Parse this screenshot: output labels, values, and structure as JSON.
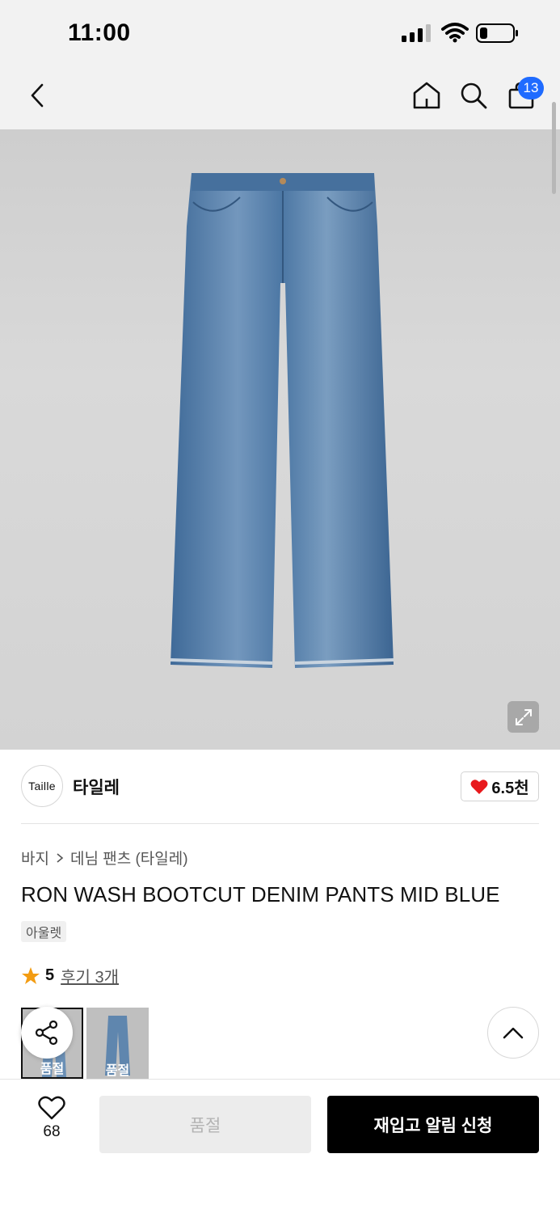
{
  "status_bar": {
    "time": "11:00"
  },
  "nav": {
    "cart_count": "13"
  },
  "brand": {
    "logo_text": "Taille",
    "name": "타일레",
    "likes": "6.5천"
  },
  "breadcrumb": [
    "바지",
    "데님 팬츠 (타일레)"
  ],
  "product": {
    "title": "RON WASH BOOTCUT DENIM PANTS MID BLUE",
    "tag": "아울렛",
    "rating": "5",
    "reviews": "후기 3개"
  },
  "thumbnails": [
    {
      "label": "품절",
      "selected": true
    },
    {
      "label": "품절",
      "selected": false
    }
  ],
  "bottom": {
    "wish_count": "68",
    "soldout_label": "품절",
    "restock_label": "재입고 알림 신청"
  },
  "colors": {
    "accent": "#1f6bff",
    "heart": "#e8191c",
    "star": "#f39c12",
    "primary_button": "#000000"
  }
}
